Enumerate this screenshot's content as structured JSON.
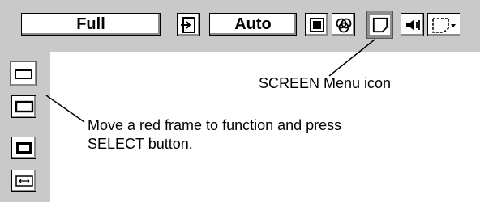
{
  "menu_bar": {
    "screen_mode_value": "Full",
    "input_mode_value": "Auto",
    "icons": [
      "input-icon",
      "image-icon",
      "color-icon",
      "screen-icon",
      "sound-icon",
      "setting-icon"
    ]
  },
  "sidebar": {
    "icons": [
      "normal-icon",
      "full-icon",
      "digital-zoom-icon",
      "true-icon"
    ]
  },
  "callouts": {
    "screen_menu_icon": "SCREEN Menu icon",
    "move_frame_line1": "Move a red frame to function and press",
    "move_frame_line2": "SELECT button."
  }
}
